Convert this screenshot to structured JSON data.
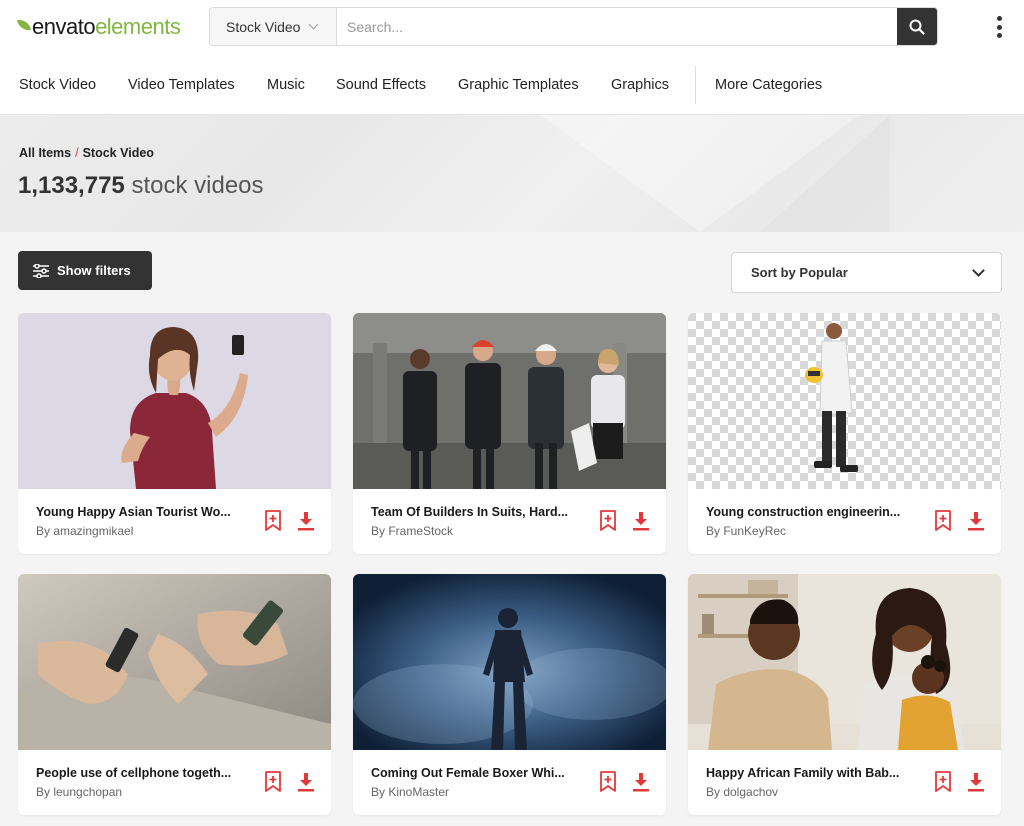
{
  "brand": {
    "word1": "envato",
    "word2": "elements"
  },
  "search": {
    "category": "Stock Video",
    "placeholder": "Search..."
  },
  "nav": [
    "Stock Video",
    "Video Templates",
    "Music",
    "Sound Effects",
    "Graphic Templates",
    "Graphics",
    "More Categories"
  ],
  "breadcrumb": {
    "root": "All Items",
    "separator": "/",
    "current": "Stock Video"
  },
  "results": {
    "count": "1,133,775",
    "label": "stock videos"
  },
  "controls": {
    "filters_label": "Show filters",
    "sort_label": "Sort by Popular"
  },
  "cards": [
    {
      "title": "Young Happy Asian Tourist Wo...",
      "author": "By amazingmikael"
    },
    {
      "title": "Team Of Builders In Suits, Hard...",
      "author": "By FrameStock"
    },
    {
      "title": "Young construction engineerin...",
      "author": "By FunKeyRec"
    },
    {
      "title": "People use of cellphone togeth...",
      "author": "By leungchopan"
    },
    {
      "title": "Coming Out Female Boxer Whi...",
      "author": "By KinoMaster"
    },
    {
      "title": "Happy African Family with Bab...",
      "author": "By dolgachov"
    }
  ],
  "colors": {
    "brand_green": "#82b541",
    "accent_red": "#e23a3a",
    "dark": "#333333"
  },
  "icons": {
    "search": "search-icon",
    "menu": "kebab-menu-icon",
    "filters": "sliders-icon",
    "bookmark": "bookmark-add-icon",
    "download": "download-icon"
  }
}
